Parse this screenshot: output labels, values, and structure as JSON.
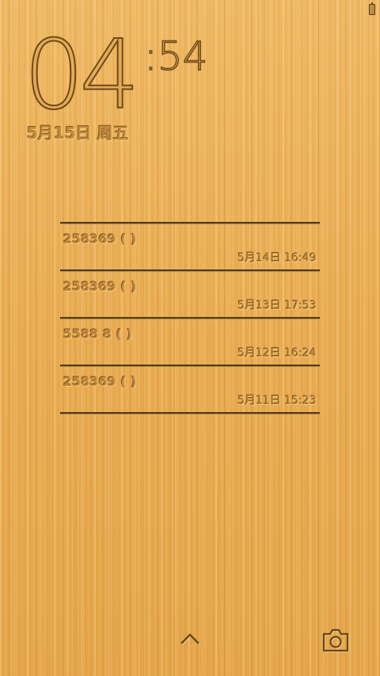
{
  "status_bar": {
    "battery_icon": "battery-icon"
  },
  "clock": {
    "hours": "04",
    "minutes": ":54",
    "date": "5月15日 周五"
  },
  "notifications": [
    {
      "title": "258369 ( )",
      "time": "5月14日 16:49"
    },
    {
      "title": "258369 ( )",
      "time": "5月13日 17:53"
    },
    {
      "title": "5588 8 ( )",
      "time": "5月12日 16:24"
    },
    {
      "title": "258369 ( )",
      "time": "5月11日 15:23"
    }
  ],
  "bottom": {
    "unlock_icon": "chevron-up-icon",
    "camera_icon": "camera-icon"
  },
  "colors": {
    "wood": "#e8a94c",
    "etch_dark": "#5a370f",
    "etch_light": "#ffe1a0"
  }
}
